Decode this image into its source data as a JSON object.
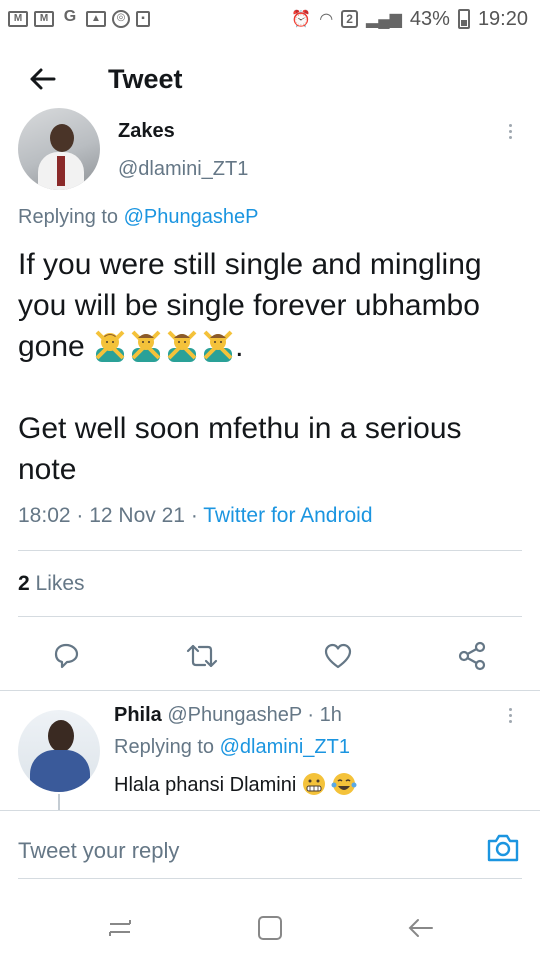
{
  "status_bar": {
    "notification_icons": [
      "gmail-icon",
      "gmail-icon",
      "google-icon",
      "image-icon",
      "sync-icon",
      "sd-card-icon"
    ],
    "alarm_icon": "alarm-icon",
    "wifi_icon": "wifi-icon",
    "sim_label": "2",
    "battery_percent": "43%",
    "time": "19:20"
  },
  "header": {
    "title": "Tweet",
    "back_icon": "back-arrow-icon"
  },
  "tweet": {
    "author_name": "Zakes",
    "author_handle": "@dlamini_ZT1",
    "replying_prefix": "Replying to",
    "replying_to": "@PhungasheP",
    "text_line1": "If you were still single and mingling you will be single forever ubhambo gone",
    "text_end": ".",
    "emoji_count": 4,
    "text_line2": "Get well soon mfethu in a serious note",
    "time": "18:02",
    "date": "12 Nov 21",
    "source": "Twitter for Android",
    "likes_count": "2",
    "likes_label": "Likes"
  },
  "actions": [
    "reply-icon",
    "retweet-icon",
    "like-icon",
    "share-icon"
  ],
  "reply": {
    "author_name": "Phila",
    "author_handle": "@PhungasheP",
    "time_ago": "1h",
    "replying_prefix": "Replying to",
    "replying_to": "@dlamini_ZT1",
    "text": "Hlala phansi Dlamini"
  },
  "compose": {
    "placeholder": "Tweet your reply"
  },
  "colors": {
    "link": "#1b95e0",
    "secondary_text": "#657786",
    "primary_text": "#14171a",
    "divider": "#d5dbe0"
  }
}
